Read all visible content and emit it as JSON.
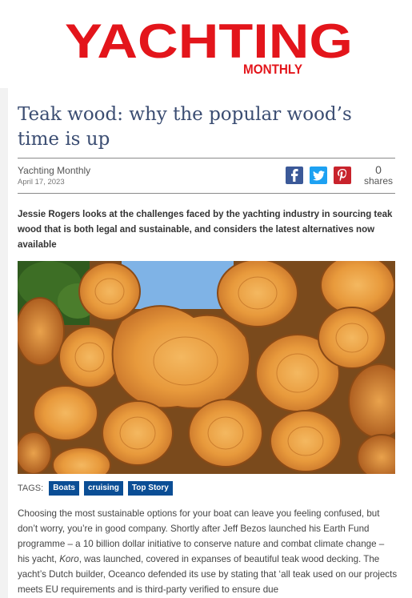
{
  "logo": {
    "main": "YACHTING",
    "sub": "MONTHLY",
    "color": "#e3151b"
  },
  "article": {
    "title": "Teak wood: why the popular wood’s time is up",
    "author": "Yachting Monthly",
    "date": "April 17, 2023",
    "standfirst": "Jessie Rogers looks at the challenges faced by the yachting industry in sourcing teak wood that is both legal and sustainable, and considers the latest alternatives now available",
    "body": {
      "p1_a": "Choosing the most sustainable options for your boat can leave you feeling confused, but don’t worry, you’re in good company. Shortly after Jeff Bezos launched his Earth Fund programme – a 10 billion dollar initiative to conserve nature and combat climate change – his yacht, ",
      "p1_em": "Koro",
      "p1_b": ", was launched, covered in expanses of beautiful teak wood decking. The yacht’s Dutch builder, Oceanco defended its use by stating that ‘all teak used on our projects meets EU requirements and is third-party verified to ensure due"
    }
  },
  "share": {
    "count": "0",
    "label": "shares",
    "facebook_icon": "facebook-icon",
    "twitter_icon": "twitter-icon",
    "pinterest_icon": "pinterest-icon",
    "colors": {
      "facebook": "#3b5998",
      "twitter": "#1da1f2",
      "pinterest": "#c8232c"
    }
  },
  "tags": {
    "label": "TAGS:",
    "items": [
      "Boats",
      "cruising",
      "Top Story"
    ],
    "color": "#0b4e95"
  }
}
